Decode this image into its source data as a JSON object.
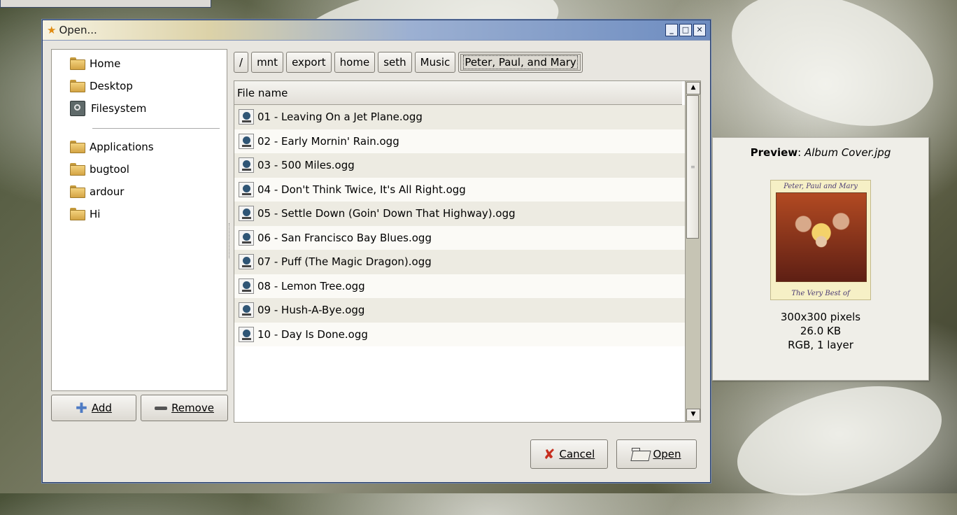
{
  "window": {
    "title": "Open..."
  },
  "places": {
    "items": [
      {
        "label": "Home",
        "icon": "folder-icon"
      },
      {
        "label": "Desktop",
        "icon": "folder-icon"
      },
      {
        "label": "Filesystem",
        "icon": "filesystem-icon"
      }
    ],
    "bookmarks": [
      {
        "label": "Applications",
        "icon": "folder-icon"
      },
      {
        "label": "bugtool",
        "icon": "folder-icon"
      },
      {
        "label": "ardour",
        "icon": "folder-icon"
      },
      {
        "label": "Hi",
        "icon": "folder-icon"
      }
    ],
    "add_label": "Add",
    "remove_label": "Remove"
  },
  "path": [
    "/",
    "mnt",
    "export",
    "home",
    "seth",
    "Music",
    "Peter, Paul, and Mary"
  ],
  "filelist": {
    "header": "File name",
    "files": [
      "01 - Leaving On a Jet Plane.ogg",
      "02 - Early Mornin' Rain.ogg",
      "03 - 500 Miles.ogg",
      "04 - Don't Think Twice, It's All Right.ogg",
      "05 - Settle Down (Goin' Down That Highway).ogg",
      "06 - San Francisco Bay Blues.ogg",
      "07 - Puff (The Magic Dragon).ogg",
      "08 - Lemon Tree.ogg",
      "09 - Hush-A-Bye.ogg",
      "10 - Day Is Done.ogg"
    ]
  },
  "buttons": {
    "cancel": "Cancel",
    "open": "Open"
  },
  "preview": {
    "label": "Preview",
    "filename": "Album Cover.jpg",
    "album_top_text": "Peter, Paul and Mary",
    "album_bottom_text": "The Very Best of",
    "dimensions": "300x300 pixels",
    "size": "26.0 KB",
    "mode": "RGB, 1 layer"
  },
  "colors": {
    "titlebar_accent": "#6d8cc0",
    "row_alt": "#edebe2"
  }
}
